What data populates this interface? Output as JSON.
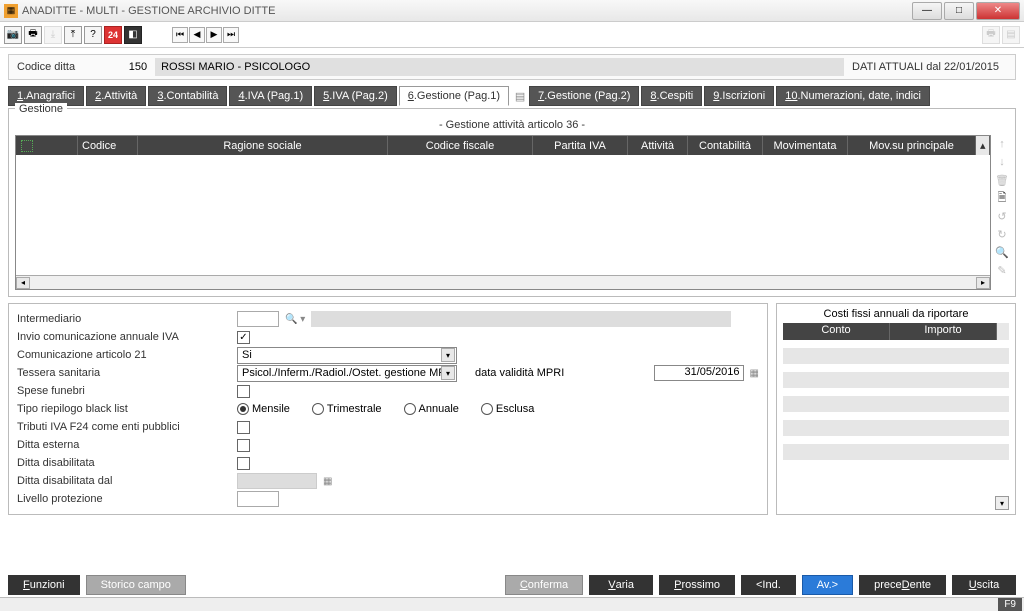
{
  "window": {
    "title": "ANADITTE  - MULTI -  GESTIONE ARCHIVIO DITTE"
  },
  "toolbar": {
    "record_nav": {
      "first": "⏮",
      "prev": "◀",
      "next": "▶",
      "last": "⏭"
    }
  },
  "header": {
    "label": "Codice ditta",
    "code": "150",
    "name": "ROSSI MARIO - PSICOLOGO",
    "dati_attuali": "DATI ATTUALI dal 22/01/2015"
  },
  "tabs": [
    {
      "key": "1",
      "label": ".Anagrafici"
    },
    {
      "key": "2",
      "label": ".Attività"
    },
    {
      "key": "3",
      "label": ".Contabilità"
    },
    {
      "key": "4",
      "label": ".IVA (Pag.1)"
    },
    {
      "key": "5",
      "label": ".IVA (Pag.2)"
    },
    {
      "key": "6",
      "label": ".Gestione (Pag.1)"
    },
    {
      "key": "7",
      "label": ".Gestione (Pag.2)"
    },
    {
      "key": "8",
      "label": ".Cespiti"
    },
    {
      "key": "9",
      "label": ".Iscrizioni"
    },
    {
      "key": "10",
      "label": ".Numerazioni, date, indici"
    }
  ],
  "gestione": {
    "legend": "Gestione",
    "subtitle": "- Gestione attività articolo 36 -",
    "columns": {
      "codice": "Codice",
      "ragione_sociale": "Ragione sociale",
      "codice_fiscale": "Codice fiscale",
      "partita_iva": "Partita IVA",
      "attivita": "Attività",
      "contabilita": "Contabilità",
      "movimentata": "Movimentata",
      "mov_su_principale": "Mov.su principale"
    }
  },
  "form": {
    "intermediario": "Intermediario",
    "invio_com_annuale": "Invio comunicazione annuale IVA",
    "invio_com_annuale_checked": "✓",
    "com_art21": "Comunicazione articolo 21",
    "com_art21_value": "Si",
    "tessera_sanitaria": "Tessera sanitaria",
    "tessera_value": "Psicol./Inferm./Radiol./Ostet. gestione MPF",
    "data_validita_label": "data validità MPRI",
    "data_validita_value": "31/05/2016",
    "spese_funebri": "Spese funebri",
    "tipo_riepilogo": "Tipo riepilogo black list",
    "radio": {
      "mensile": "Mensile",
      "trimestrale": "Trimestrale",
      "annuale": "Annuale",
      "esclusa": "Esclusa"
    },
    "tributi_f24": "Tributi IVA F24 come enti pubblici",
    "ditta_esterna": "Ditta esterna",
    "ditta_disabilitata": "Ditta disabilitata",
    "ditta_disab_dal": "Ditta disabilitata dal",
    "livello_protezione": "Livello protezione"
  },
  "costs": {
    "title": "Costi fissi annuali da riportare",
    "col_conto": "Conto",
    "col_importo": "Importo"
  },
  "buttons": {
    "funzioni": "Funzioni",
    "storico": "Storico campo",
    "conferma": "Conferma",
    "varia": "Varia",
    "prossimo": "Prossimo",
    "ind": "<Ind.",
    "av": "Av.>",
    "precedente": "preceDente",
    "uscita": "Uscita"
  },
  "status": {
    "f9": "F9"
  }
}
